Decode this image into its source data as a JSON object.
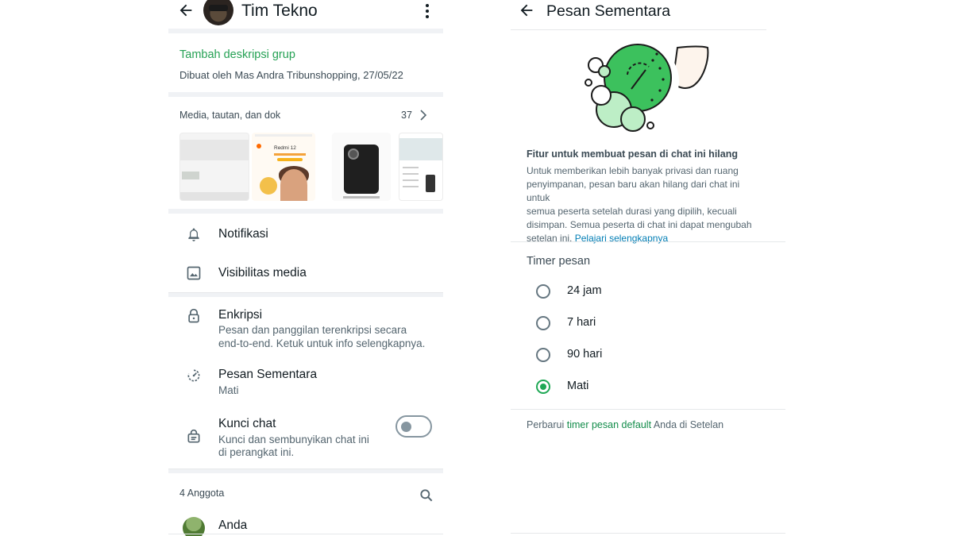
{
  "left": {
    "title": "Tim Tekno",
    "description_cta": "Tambah deskripsi grup",
    "created_by": "Dibuat oleh Mas Andra Tribunshopping, 27/05/22",
    "media": {
      "label": "Media, tautan, dan dok",
      "count": "37",
      "thumb_redmi_text": "Redmi 12"
    },
    "notifications_label": "Notifikasi",
    "media_visibility_label": "Visibilitas media",
    "encryption": {
      "title": "Enkripsi",
      "subtitle_line1": "Pesan dan panggilan terenkripsi secara",
      "subtitle_line2": "end-to-end. Ketuk untuk info selengkapnya."
    },
    "disappearing": {
      "title": "Pesan Sementara",
      "subtitle": "Mati"
    },
    "chat_lock": {
      "title": "Kunci chat",
      "subtitle_line1": "Kunci dan sembunyikan chat ini",
      "subtitle_line2": "di perangkat ini.",
      "enabled": false
    },
    "members_label": "4 Anggota",
    "first_member": "Anda",
    "icons": {
      "back": "back-arrow-icon",
      "menu": "kebab-menu-icon",
      "chevron": "chevron-right-icon",
      "bell": "bell-icon",
      "image": "image-icon",
      "lock": "lock-icon",
      "timer": "timer-icon",
      "chat_lock": "chat-lock-icon",
      "search": "search-icon"
    }
  },
  "right": {
    "title": "Pesan Sementara",
    "heading": "Fitur untuk membuat pesan di chat ini hilang",
    "desc_line1": "Untuk memberikan lebih banyak privasi dan ruang",
    "desc_line2": "penyimpanan, pesan baru akan hilang dari chat ini untuk",
    "desc_line3": "semua peserta setelah durasi yang dipilih, kecuali",
    "desc_line4": "disimpan. Semua peserta di chat ini dapat mengubah",
    "desc_line5_prefix": "setelan ini.",
    "learn_more": "Pelajari selengkapnya",
    "timer_label": "Timer pesan",
    "options": [
      {
        "label": "24 jam",
        "selected": false
      },
      {
        "label": "7 hari",
        "selected": false
      },
      {
        "label": "90 hari",
        "selected": false
      },
      {
        "label": "Mati",
        "selected": true
      }
    ],
    "footer_prefix": "Perbarui",
    "footer_link": "timer pesan default",
    "footer_suffix": "Anda di Setelan"
  },
  "colors": {
    "accent_green": "#25a154",
    "radio_selected": "#1fa855",
    "link_blue": "#027eb5",
    "text_primary": "#111b21",
    "text_secondary": "#54656f"
  }
}
